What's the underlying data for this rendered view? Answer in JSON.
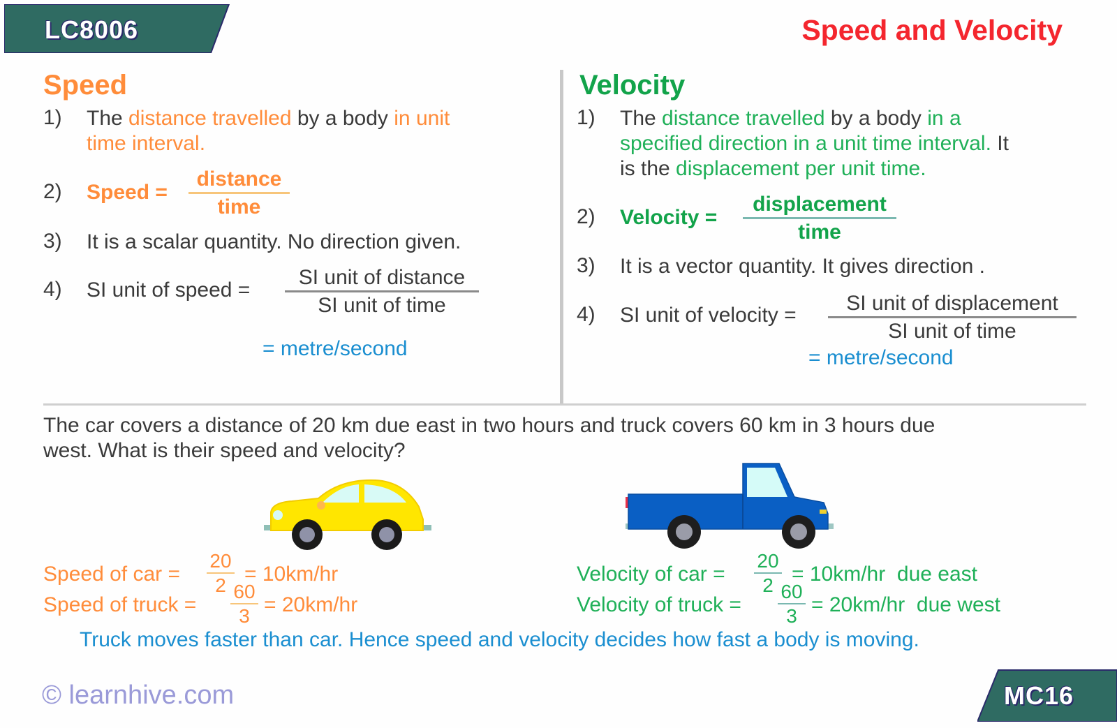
{
  "header": {
    "code": "LC8006",
    "title": "Speed and Velocity",
    "title_color": "#f4262e",
    "tag_color": "#2f6b62"
  },
  "speed": {
    "heading": "Speed",
    "items": [
      {
        "num": "1)",
        "parts": [
          "The ",
          "distance travelled",
          " by a body ",
          "in unit",
          "time interval."
        ]
      },
      {
        "num": "2)",
        "label": "Speed =",
        "numerator": "distance",
        "denominator": "time"
      },
      {
        "num": "3)",
        "text": "It is a scalar quantity. No direction given."
      },
      {
        "num": "4)",
        "label": "SI unit of speed =",
        "numerator": "SI unit of distance",
        "denominator": "SI unit of time",
        "result": "= metre/second"
      }
    ]
  },
  "velocity": {
    "heading": "Velocity",
    "items": [
      {
        "num": "1)",
        "parts": [
          "The ",
          "distance travelled",
          " by a body ",
          "in a",
          "specified direction in a unit time interval.",
          " It",
          "is the ",
          "displacement per unit time."
        ]
      },
      {
        "num": "2)",
        "label": "Velocity =",
        "numerator": "displacement",
        "denominator": "time"
      },
      {
        "num": "3)",
        "text": "It is a vector quantity. It gives direction ."
      },
      {
        "num": "4)",
        "label": "SI unit of velocity =",
        "numerator": "SI unit of displacement",
        "denominator": "SI unit of time",
        "result": "= metre/second"
      }
    ]
  },
  "problem": {
    "line1": "The car covers a distance of 20 km due east in two hours and truck covers 60 km in 3 hours due",
    "line2": "west. What is their speed and velocity?"
  },
  "vehicles": {
    "car": {
      "icon": "car-icon",
      "color": "#ffe600"
    },
    "truck": {
      "icon": "truck-icon",
      "color": "#0a5fc4"
    }
  },
  "answers": {
    "speed_car": {
      "label": "Speed of car =",
      "num": "20",
      "den": "2",
      "result": "= 10km/hr"
    },
    "speed_truck": {
      "label": "Speed of truck =",
      "num": "60",
      "den": "3",
      "result": "= 20km/hr"
    },
    "velocity_car": {
      "label": "Velocity of car =",
      "num": "20",
      "den": "2",
      "result": "= 10km/hr  due east"
    },
    "velocity_truck": {
      "label": "Velocity of truck =",
      "num": "60",
      "den": "3",
      "result": "= 20km/hr  due west"
    }
  },
  "conclusion": "Truck moves faster than car. Hence speed and velocity decides how fast a body is moving.",
  "footer": {
    "copyright": "© learnhive.com",
    "page_code": "MC16"
  }
}
